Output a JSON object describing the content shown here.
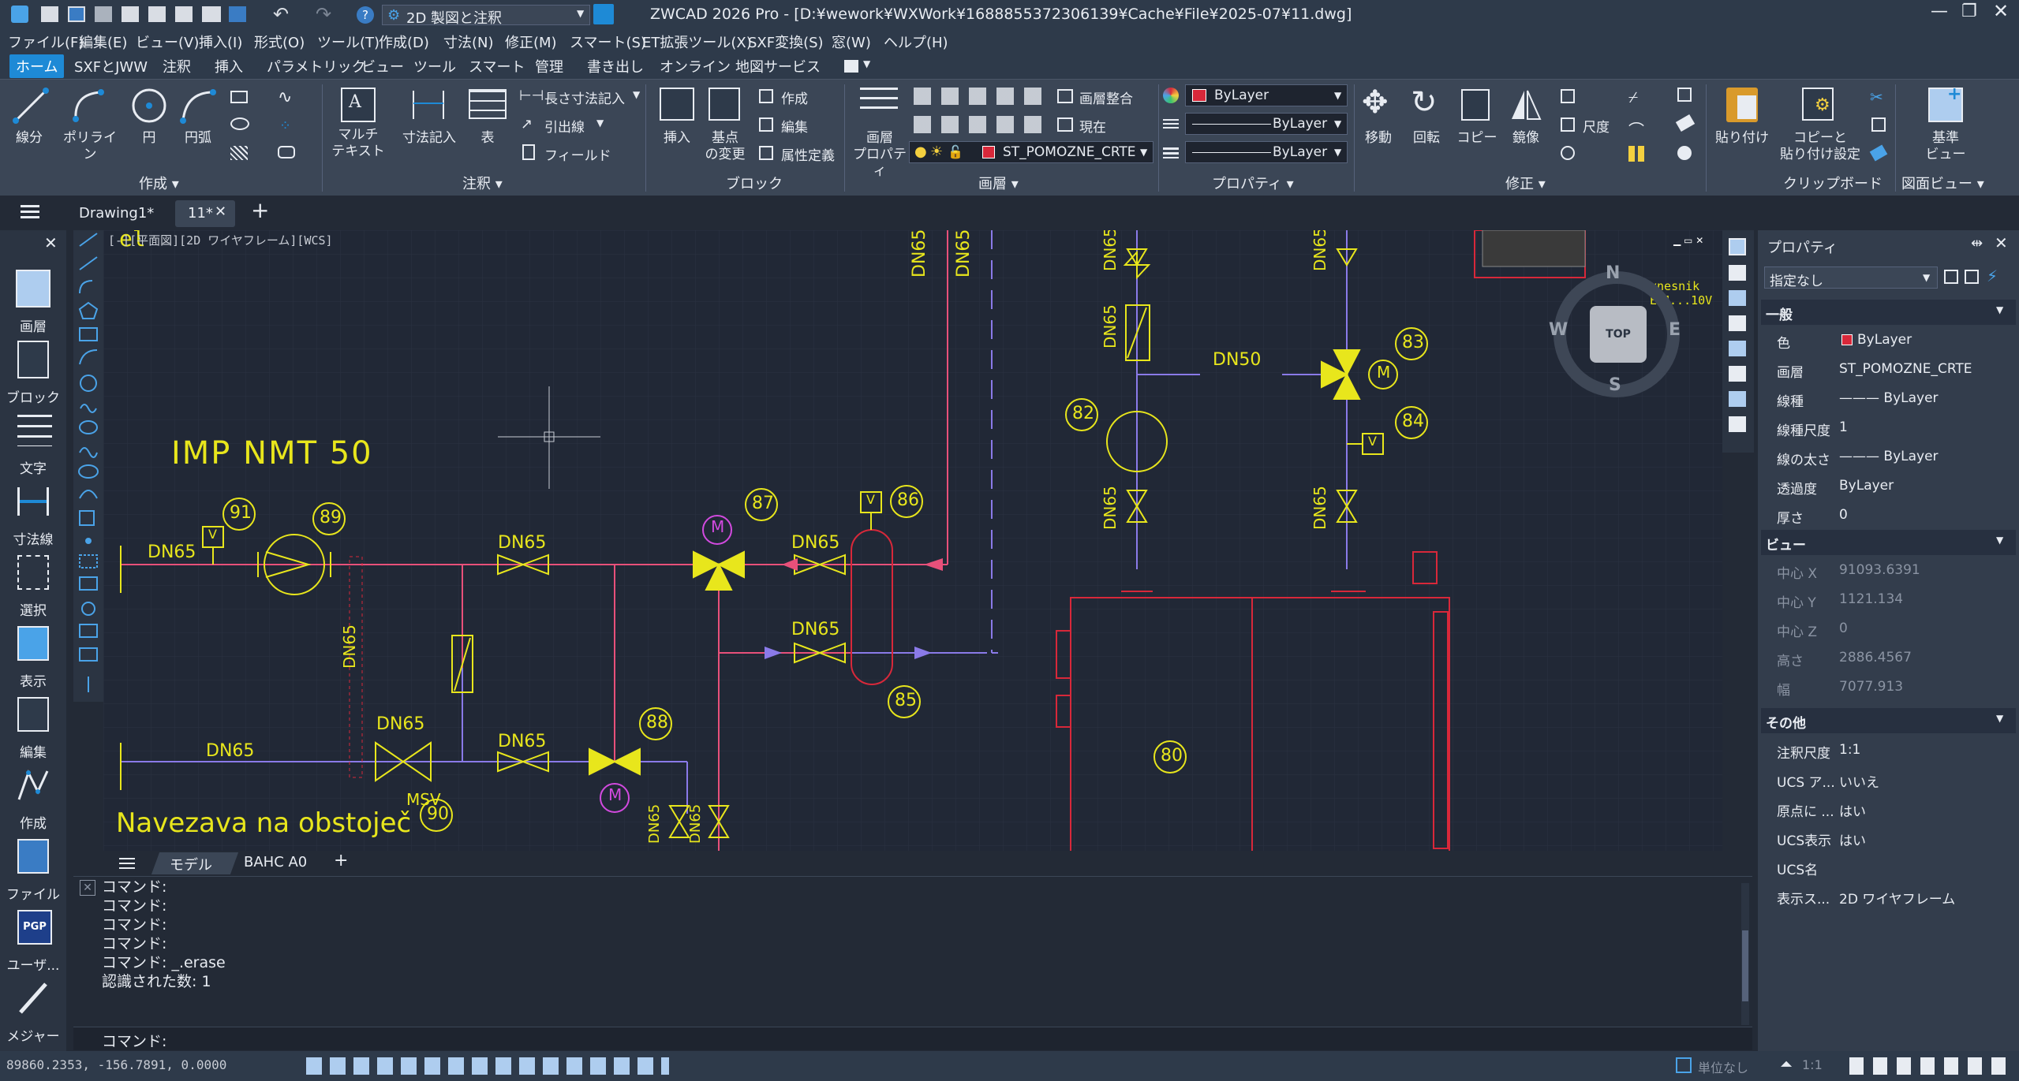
{
  "titlebar": {
    "workspace": "2D 製図と注釈",
    "title": "ZWCAD 2026 Pro - [D:¥wework¥WXWork¥1688855372306139¥Cache¥File¥2025-07¥11.dwg]"
  },
  "menu": [
    "ファイル(F)",
    "編集(E)",
    "ビュー(V)",
    "挿入(I)",
    "形式(O)",
    "ツール(T)",
    "作成(D)",
    "寸法(N)",
    "修正(M)",
    "スマート(S)",
    "ET拡張ツール(X)",
    "SXF変換(S)",
    "窓(W)",
    "ヘルプ(H)"
  ],
  "ribbon_tabs": [
    "ホーム",
    "SXFとJWW",
    "注釈",
    "挿入",
    "パラメトリック",
    "ビュー",
    "ツール",
    "スマート",
    "管理",
    "書き出し",
    "オンライン",
    "地図サービス"
  ],
  "ribbon": {
    "create": {
      "label": "作成",
      "line": "線分",
      "polyline": "ポリライン",
      "circle": "円",
      "arc": "円弧"
    },
    "annot": {
      "label": "注釈",
      "mtext": "マルチ\nテキスト",
      "dim": "寸法記入",
      "table": "表",
      "linear": "長さ寸法記入",
      "leader": "引出線",
      "field": "フィールド"
    },
    "block": {
      "label": "ブロック",
      "insert": "挿入",
      "base": "基点\nの変更",
      "create": "作成",
      "edit": "編集",
      "attdef": "属性定義"
    },
    "layer": {
      "label": "画層",
      "props": "画層\nプロパティ",
      "match": "画層整合",
      "current": "現在",
      "layer_name": "ST_POMOZNE_CRTE"
    },
    "properties": {
      "label": "プロパティ",
      "color": "ByLayer",
      "linetype": "ByLayer",
      "lineweight": "ByLayer"
    },
    "modify": {
      "label": "修正",
      "move": "移動",
      "rotate": "回転",
      "copy": "コピー",
      "mirror": "鏡像",
      "scale": "尺度"
    },
    "clipboard": {
      "label": "クリップボード",
      "paste": "貼り付け",
      "copybase": "コピーと\n貼り付け設定"
    },
    "view": {
      "label": "図面ビュー",
      "base": "基準\nビュー"
    }
  },
  "doctabs": {
    "tab1": "Drawing1*",
    "tab2": "11*"
  },
  "leftpanel": [
    {
      "label": "画層"
    },
    {
      "label": "ブロック"
    },
    {
      "label": "文字"
    },
    {
      "label": "寸法線"
    },
    {
      "label": "選択"
    },
    {
      "label": "表示"
    },
    {
      "label": "編集"
    },
    {
      "label": "作成"
    },
    {
      "label": "ファイル"
    },
    {
      "label": "ユーザ..."
    },
    {
      "label": "メジャー"
    }
  ],
  "canvas": {
    "viewport_label": "[-][平面図][2D ワイヤフレーム][WCS]",
    "texts": {
      "imp": "IMP NMT 50",
      "navezava": "Navezava na obstoječ",
      "dn65": "DN65",
      "dn50": "DN50",
      "msv": "MSV",
      "m": "M",
      "v": "V",
      "vnesnik": "vnesnik EA1",
      "range": "0...10V"
    },
    "bubbles": [
      "91",
      "89",
      "87",
      "86",
      "88",
      "85",
      "90",
      "82",
      "83",
      "84",
      "80"
    ],
    "viewcube": {
      "top": "TOP",
      "n": "N",
      "s": "S",
      "e": "E",
      "w": "W"
    }
  },
  "properties": {
    "title": "プロパティ",
    "selection": "指定なし",
    "sections": {
      "general": "一般",
      "view": "ビュー",
      "misc": "その他"
    },
    "general": [
      {
        "k": "色",
        "v": "ByLayer"
      },
      {
        "k": "画層",
        "v": "ST_POMOZNE_CRTE"
      },
      {
        "k": "線種",
        "v": "——— ByLayer"
      },
      {
        "k": "線種尺度",
        "v": "1"
      },
      {
        "k": "線の太さ",
        "v": "——— ByLayer"
      },
      {
        "k": "透過度",
        "v": "ByLayer"
      },
      {
        "k": "厚さ",
        "v": "0"
      }
    ],
    "view": [
      {
        "k": "中心 X",
        "v": "91093.6391"
      },
      {
        "k": "中心 Y",
        "v": "1121.134"
      },
      {
        "k": "中心 Z",
        "v": "0"
      },
      {
        "k": "高さ",
        "v": "2886.4567"
      },
      {
        "k": "幅",
        "v": "7077.913"
      }
    ],
    "misc": [
      {
        "k": "注釈尺度",
        "v": "1:1"
      },
      {
        "k": "UCS ア...",
        "v": "いいえ"
      },
      {
        "k": "原点に ...",
        "v": "はい"
      },
      {
        "k": "UCS表示",
        "v": "はい"
      },
      {
        "k": "UCS名",
        "v": ""
      },
      {
        "k": "表示ス...",
        "v": "2D ワイヤフレーム"
      }
    ]
  },
  "layouttabs": {
    "model": "モデル",
    "layout1": "ВАНС А0",
    "plus": "+"
  },
  "command": {
    "history": [
      "コマンド:",
      "コマンド:",
      "コマンド:",
      "コマンド:",
      "コマンド: _.erase",
      "認識された数: 1"
    ],
    "prompt": "コマンド:"
  },
  "status": {
    "coords": "89860.2353, -156.7891, 0.0000",
    "units": "単位なし",
    "scale": "1:1"
  },
  "colors": {
    "accent": "#1e8ad6",
    "yellow": "#e8e61c",
    "red": "#d8283a",
    "pink": "#e8507a",
    "purple": "#8a7ae8"
  }
}
